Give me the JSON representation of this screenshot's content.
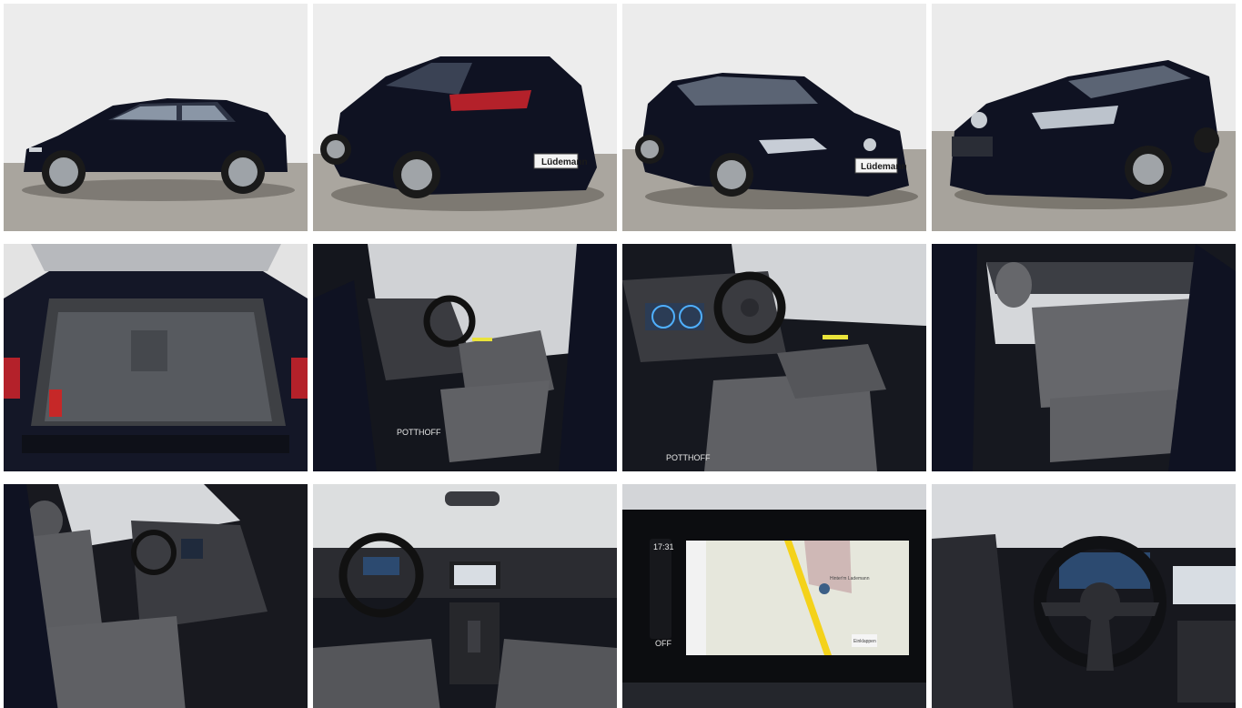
{
  "gallery": {
    "tiles": [
      {
        "id": 1,
        "subject": "side-view"
      },
      {
        "id": 2,
        "subject": "rear-three-quarter"
      },
      {
        "id": 3,
        "subject": "front-three-quarter"
      },
      {
        "id": 4,
        "subject": "front-view"
      },
      {
        "id": 5,
        "subject": "trunk"
      },
      {
        "id": 6,
        "subject": "driver-door-interior"
      },
      {
        "id": 7,
        "subject": "driver-seat-dashboard"
      },
      {
        "id": 8,
        "subject": "rear-seats"
      },
      {
        "id": 9,
        "subject": "passenger-side-interior"
      },
      {
        "id": 10,
        "subject": "dashboard-overview"
      },
      {
        "id": 11,
        "subject": "infotainment-screen"
      },
      {
        "id": 12,
        "subject": "steering-wheel"
      }
    ]
  },
  "labels": {
    "dealer_plate": "Lüdemann",
    "floor_mat_brand": "POTTHOFF",
    "clock": "17:31",
    "climate_off": "OFF",
    "map_street": "Hinter'm Lademann",
    "map_badge": "Einklappen"
  },
  "colors": {
    "car_body": "#0d1020",
    "studio_wall": "#ebebeb",
    "studio_floor": "#a7a39c",
    "interior_fabric": "#5c5d60",
    "ambient_accent": "#e9e33a",
    "cluster_blue": "#4fb0ff",
    "map_route": "#f4d21a"
  }
}
